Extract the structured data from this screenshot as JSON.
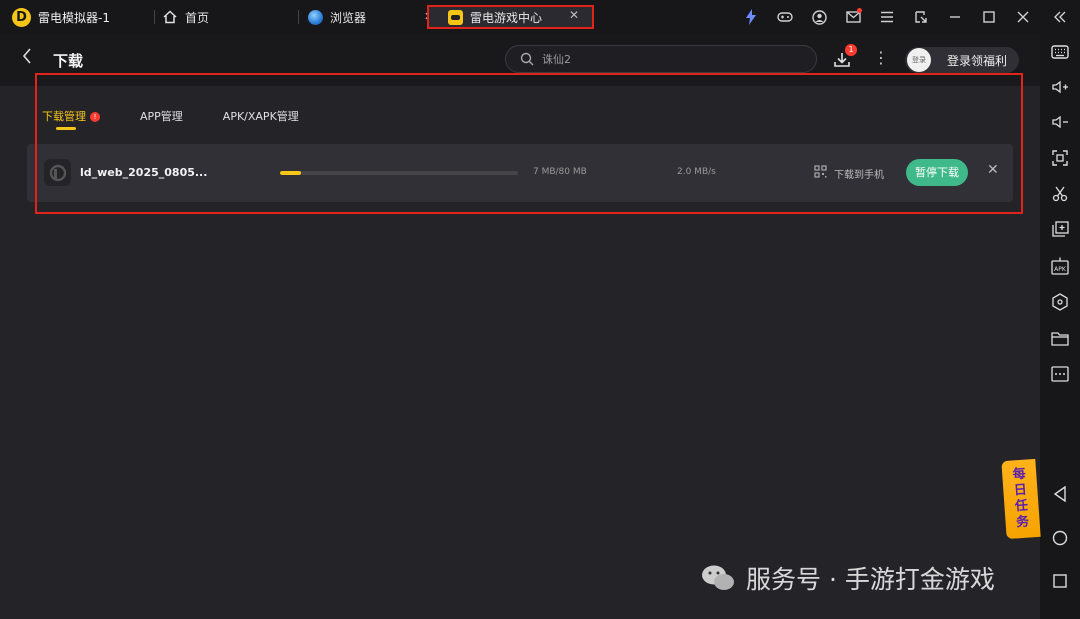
{
  "titlebar": {
    "app_name": "雷电模拟器-1",
    "tabs": [
      {
        "label": "首页"
      },
      {
        "label": "浏览器"
      },
      {
        "label": "雷电游戏中心"
      }
    ]
  },
  "header": {
    "title": "下载",
    "search_placeholder": "诛仙2",
    "download_badge": "1",
    "login_avatar_text": "登录",
    "login_label": "登录领福利"
  },
  "subtabs": [
    {
      "label": "下载管理",
      "badge": "!"
    },
    {
      "label": "APP管理"
    },
    {
      "label": "APK/XAPK管理"
    }
  ],
  "download": {
    "name": "ld_web_2025_0805...",
    "progress_fraction": 0.09,
    "size": "7 MB/80 MB",
    "speed": "2.0 MB/s",
    "to_phone_label": "下载到手机",
    "pause_label": "暂停下载"
  },
  "daily_task": [
    "每",
    "日",
    "任",
    "务"
  ],
  "watermark": "服务号 · 手游打金游戏",
  "colors": {
    "accent_yellow": "#f5c518",
    "pause_green": "#3fb98a",
    "badge_red": "#ff3b30",
    "highlight_red": "#e2231a"
  }
}
